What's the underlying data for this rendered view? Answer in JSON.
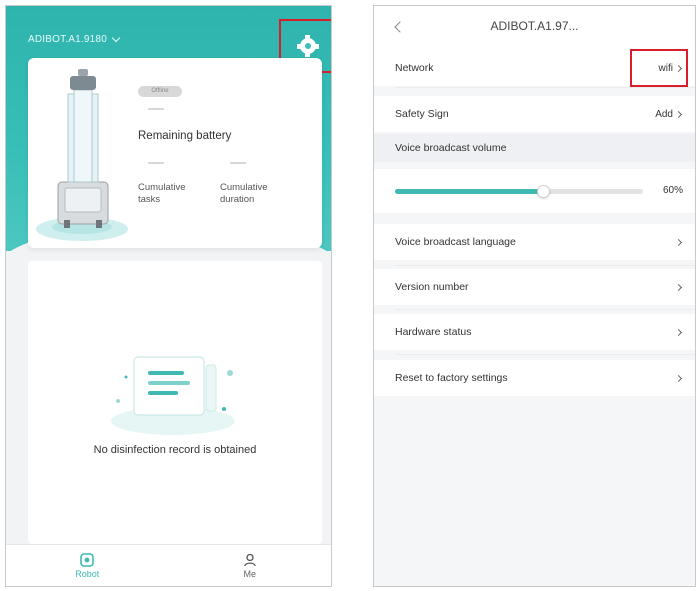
{
  "left": {
    "robot_name": "ADIBOT.A1.9180",
    "status_text": "Offline",
    "battery_label": "Remaining battery",
    "cumulative_tasks_label": [
      "Cumulative",
      "tasks"
    ],
    "cumulative_duration_label": [
      "Cumulative",
      "duration"
    ],
    "empty_record_text": "No disinfection record is obtained",
    "tabs": [
      {
        "label": "Robot",
        "icon": "robot-icon",
        "active": true
      },
      {
        "label": "Me",
        "icon": "person-icon",
        "active": false
      }
    ]
  },
  "right": {
    "title": "ADIBOT.A1.97...",
    "rows": [
      {
        "label": "Network",
        "value": "wifi"
      },
      {
        "label": "Safety Sign",
        "value": "Add"
      }
    ],
    "volume_section": "Voice broadcast volume",
    "volume_percent": 60,
    "volume_label": "60%",
    "menu": [
      {
        "label": "Voice broadcast language"
      },
      {
        "label": "Version number"
      },
      {
        "label": "Hardware status"
      },
      {
        "label": "Reset to factory settings"
      }
    ]
  },
  "colors": {
    "teal": "#3fb9b2",
    "highlight": "#d81e2a"
  }
}
